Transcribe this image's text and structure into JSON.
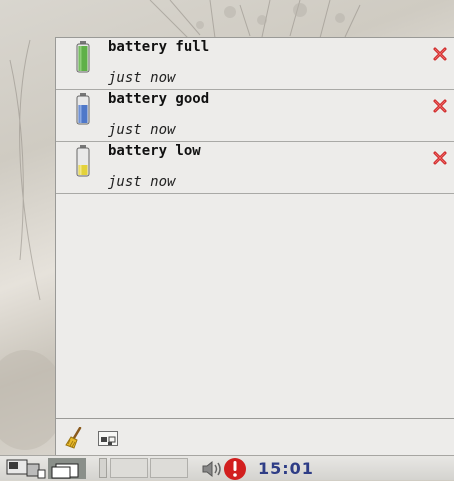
{
  "notifications": [
    {
      "title": "battery full",
      "time": "just now",
      "icon": "battery-full-icon",
      "color": "#5fb048"
    },
    {
      "title": "battery good",
      "time": "just now",
      "icon": "battery-good-icon",
      "color": "#4f78c9"
    },
    {
      "title": "battery low",
      "time": "just now",
      "icon": "battery-low-icon",
      "color": "#e4d23a"
    }
  ],
  "footer": {
    "clear_icon": "broom-icon",
    "dnd_icon": "display-toggle-icon"
  },
  "taskbar": {
    "clock": "15:01",
    "icons": [
      "desktop-pager-icon",
      "window-list-icon",
      "volume-icon",
      "alert-icon"
    ]
  }
}
